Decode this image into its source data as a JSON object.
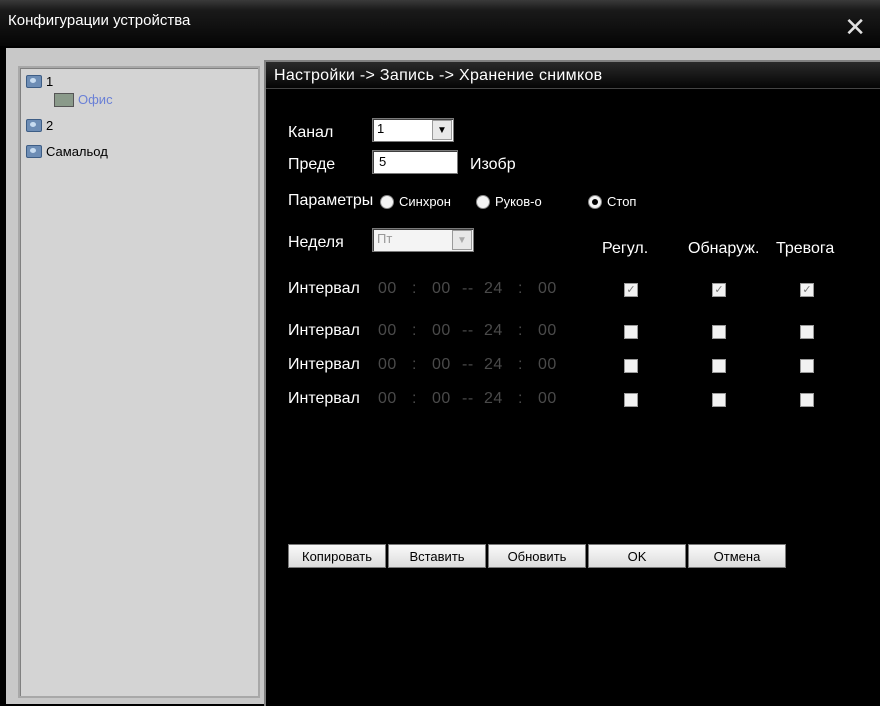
{
  "window": {
    "title": "Конфигурации устройства",
    "close_glyph": "✕"
  },
  "tree": {
    "items": [
      {
        "label": "1",
        "icon": "camera-icon"
      },
      {
        "label": "Офис",
        "icon": "device-icon"
      },
      {
        "label": "2",
        "icon": "camera-icon"
      },
      {
        "label": "Самальод",
        "icon": "camera-icon"
      }
    ]
  },
  "panel": {
    "breadcrumb": "Настройки -> Запись -> Хранение снимков",
    "channel": {
      "label": "Канал",
      "value": "1"
    },
    "pre": {
      "label": "Преде",
      "value": "5",
      "unit": "Изобр"
    },
    "params": {
      "label": "Параметры",
      "options": [
        "Синхрон",
        "Руков-о",
        "Стоп"
      ],
      "selected": 2
    },
    "week": {
      "label": "Неделя",
      "value": "Пт"
    },
    "columns": [
      "Регул.",
      "Обнаруж.",
      "Тревога"
    ],
    "intervals": [
      {
        "label": "Интервал",
        "start_h": "00",
        "start_m": "00",
        "sep": "--",
        "end_h": "24",
        "end_m": "00",
        "checked": [
          true,
          true,
          true
        ]
      },
      {
        "label": "Интервал",
        "start_h": "00",
        "start_m": "00",
        "sep": "--",
        "end_h": "24",
        "end_m": "00",
        "checked": [
          false,
          false,
          false
        ]
      },
      {
        "label": "Интервал",
        "start_h": "00",
        "start_m": "00",
        "sep": "--",
        "end_h": "24",
        "end_m": "00",
        "checked": [
          false,
          false,
          false
        ]
      },
      {
        "label": "Интервал",
        "start_h": "00",
        "start_m": "00",
        "sep": "--",
        "end_h": "24",
        "end_m": "00",
        "checked": [
          false,
          false,
          false
        ]
      }
    ],
    "buttons": {
      "copy": "Копировать",
      "paste": "Вставить",
      "refresh": "Обновить",
      "ok": "OK",
      "cancel": "Отмена"
    }
  },
  "colors": {
    "panel_bg": "#000000",
    "tree_bg": "#d4d4d4",
    "sub_item": "#6a80d6",
    "disabled_text": "#4a4a4a"
  }
}
